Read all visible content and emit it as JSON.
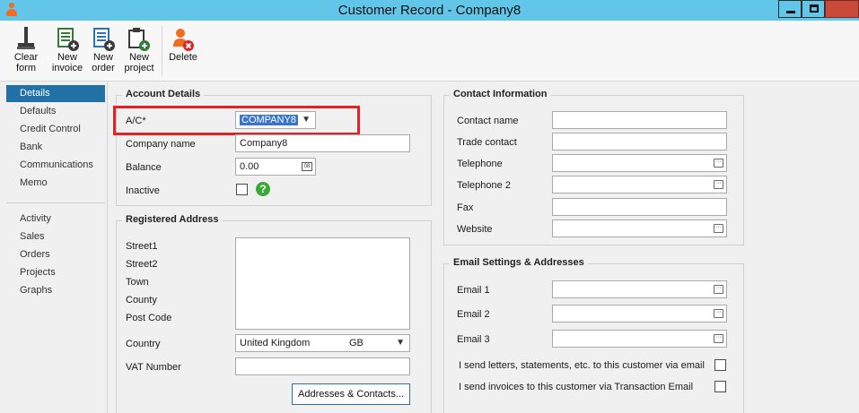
{
  "window": {
    "title": "Customer Record - Company8"
  },
  "toolbar": {
    "clear_form": "Clear\nform",
    "new_invoice": "New\ninvoice",
    "new_order": "New\norder",
    "new_project": "New\nproject",
    "delete": "Delete"
  },
  "sidebar": {
    "items": [
      {
        "label": "Details"
      },
      {
        "label": "Defaults"
      },
      {
        "label": "Credit Control"
      },
      {
        "label": "Bank"
      },
      {
        "label": "Communications"
      },
      {
        "label": "Memo"
      }
    ],
    "items2": [
      {
        "label": "Activity"
      },
      {
        "label": "Sales"
      },
      {
        "label": "Orders"
      },
      {
        "label": "Projects"
      },
      {
        "label": "Graphs"
      }
    ]
  },
  "account": {
    "title": "Account Details",
    "ac_label": "A/C*",
    "ac_value": "COMPANY8",
    "company_label": "Company name",
    "company_value": "Company8",
    "balance_label": "Balance",
    "balance_value": "0.00",
    "inactive_label": "Inactive"
  },
  "address": {
    "title": "Registered Address",
    "street1": "Street1",
    "street2": "Street2",
    "town": "Town",
    "county": "County",
    "postcode": "Post Code",
    "country_label": "Country",
    "country_value": "United Kingdom",
    "country_code": "GB",
    "vat_label": "VAT Number",
    "addresses_button": "Addresses & Contacts..."
  },
  "contact": {
    "title": "Contact Information",
    "contact_name": "Contact name",
    "trade_contact": "Trade contact",
    "telephone": "Telephone",
    "telephone2": "Telephone 2",
    "fax": "Fax",
    "website": "Website"
  },
  "email": {
    "title": "Email Settings & Addresses",
    "email1": "Email 1",
    "email2": "Email 2",
    "email3": "Email 3",
    "send_letters": "I send letters, statements, etc. to this customer via email",
    "send_invoices": "I send invoices to this customer via Transaction Email"
  },
  "colors": {
    "titlebar": "#62c6e9",
    "accent": "#2170a6",
    "highlight": "#e32126",
    "help": "#3aa935"
  }
}
